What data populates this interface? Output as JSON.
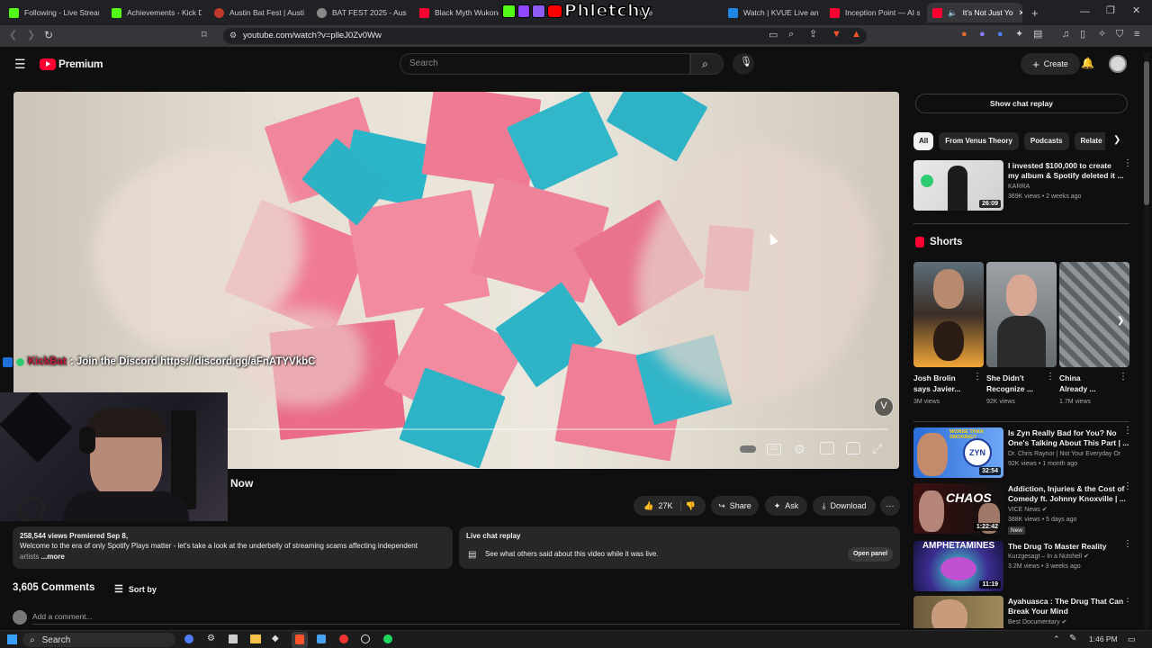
{
  "browser": {
    "tabs": [
      {
        "title": "Following - Live Stream",
        "color": "#53fc18"
      },
      {
        "title": "Achievements - Kick D",
        "color": "#53fc18"
      },
      {
        "title": "Austin Bat Fest | Austi",
        "color": "#c0392b"
      },
      {
        "title": "BAT FEST 2025 - Austi",
        "color": "#888888"
      },
      {
        "title": "Black Myth Wukong",
        "color": "#ff0033"
      },
      {
        "title": "Tube",
        "color": "#ff0033"
      },
      {
        "title": "Watch | KVUE Live and",
        "color": "#1e88e5"
      },
      {
        "title": "Inception Point — AI s",
        "color": "#ff0033"
      },
      {
        "title": "It's Not Just Yo",
        "color": "#ff0033"
      }
    ],
    "url": "youtube.com/watch?v=plleJ0Zv0Ww",
    "overlay_logo": "Phletchy"
  },
  "youtube": {
    "logo": "Premium",
    "search_placeholder": "Search",
    "create_label": "Create"
  },
  "video": {
    "chat_user": "KickBat",
    "chat_message": ": Join the Discord https://discord.gg/aFnATYVkbC",
    "title_tail": "Now"
  },
  "actions": {
    "likes": "27K",
    "share": "Share",
    "ask": "Ask",
    "download": "Download"
  },
  "description": {
    "stats": "258,544 views  Premiered Sep 8,",
    "text_line1": "Welcome to the era of only Spotify Plays matter - let's take a look at the underbelly of streaming scams affecting independent",
    "text_line2": "artists",
    "more": "...more"
  },
  "live_chat": {
    "title": "Live chat replay",
    "body": "See what others said about this video while it was live.",
    "open_panel": "Open panel"
  },
  "comments": {
    "count": "3,605 Comments",
    "sort": "Sort by",
    "add": "Add a comment..."
  },
  "sidebar": {
    "show_chat_replay": "Show chat replay",
    "chips": [
      "All",
      "From Venus Theory",
      "Podcasts",
      "Relate"
    ],
    "first_rec": {
      "title1": "I invested $100,000 to create",
      "title2": "my album & Spotify deleted it ...",
      "channel": "KARRA",
      "meta": "369K views • 2 weeks ago",
      "duration": "26:09"
    },
    "shorts_label": "Shorts",
    "shorts": [
      {
        "title1": "Josh Brolin",
        "title2": "says Javier...",
        "views": "3M views"
      },
      {
        "title1": "She Didn't",
        "title2": "Recognize ...",
        "views": "92K views"
      },
      {
        "title1": "China",
        "title2": "Already ...",
        "views": "1.7M views"
      }
    ],
    "recs": [
      {
        "title1": "Is Zyn Really Bad for You? No",
        "title2": "One's Talking About This Part | ...",
        "channel": "Dr. Chris Raynor | Not Your Everyday Orth...",
        "meta": "92K views • 1 month ago",
        "duration": "32:54",
        "badge": ""
      },
      {
        "title1": "Addiction, Injuries & the Cost of",
        "title2": "Comedy ft. Johnny Knoxville | ...",
        "channel": "VICE News",
        "meta": "388K views • 5 days ago",
        "duration": "1:22:42",
        "badge": "New"
      },
      {
        "title1": "The Drug To Master Reality",
        "title2": "",
        "channel": "Kurzgesagt – In a Nutshell",
        "meta": "3.2M views • 3 weeks ago",
        "duration": "11:19",
        "badge": ""
      },
      {
        "title1": "Ayahuasca : The Drug That Can",
        "title2": "Break Your Mind",
        "channel": "Best Documentary",
        "meta": "",
        "duration": "",
        "badge": ""
      }
    ],
    "thumb_texts": [
      "WORSE THAN SMOKING?",
      "ZYN",
      "CHAOS",
      "AMPHETAMINES"
    ]
  },
  "taskbar": {
    "search": "Search",
    "time": "1:46 PM"
  }
}
